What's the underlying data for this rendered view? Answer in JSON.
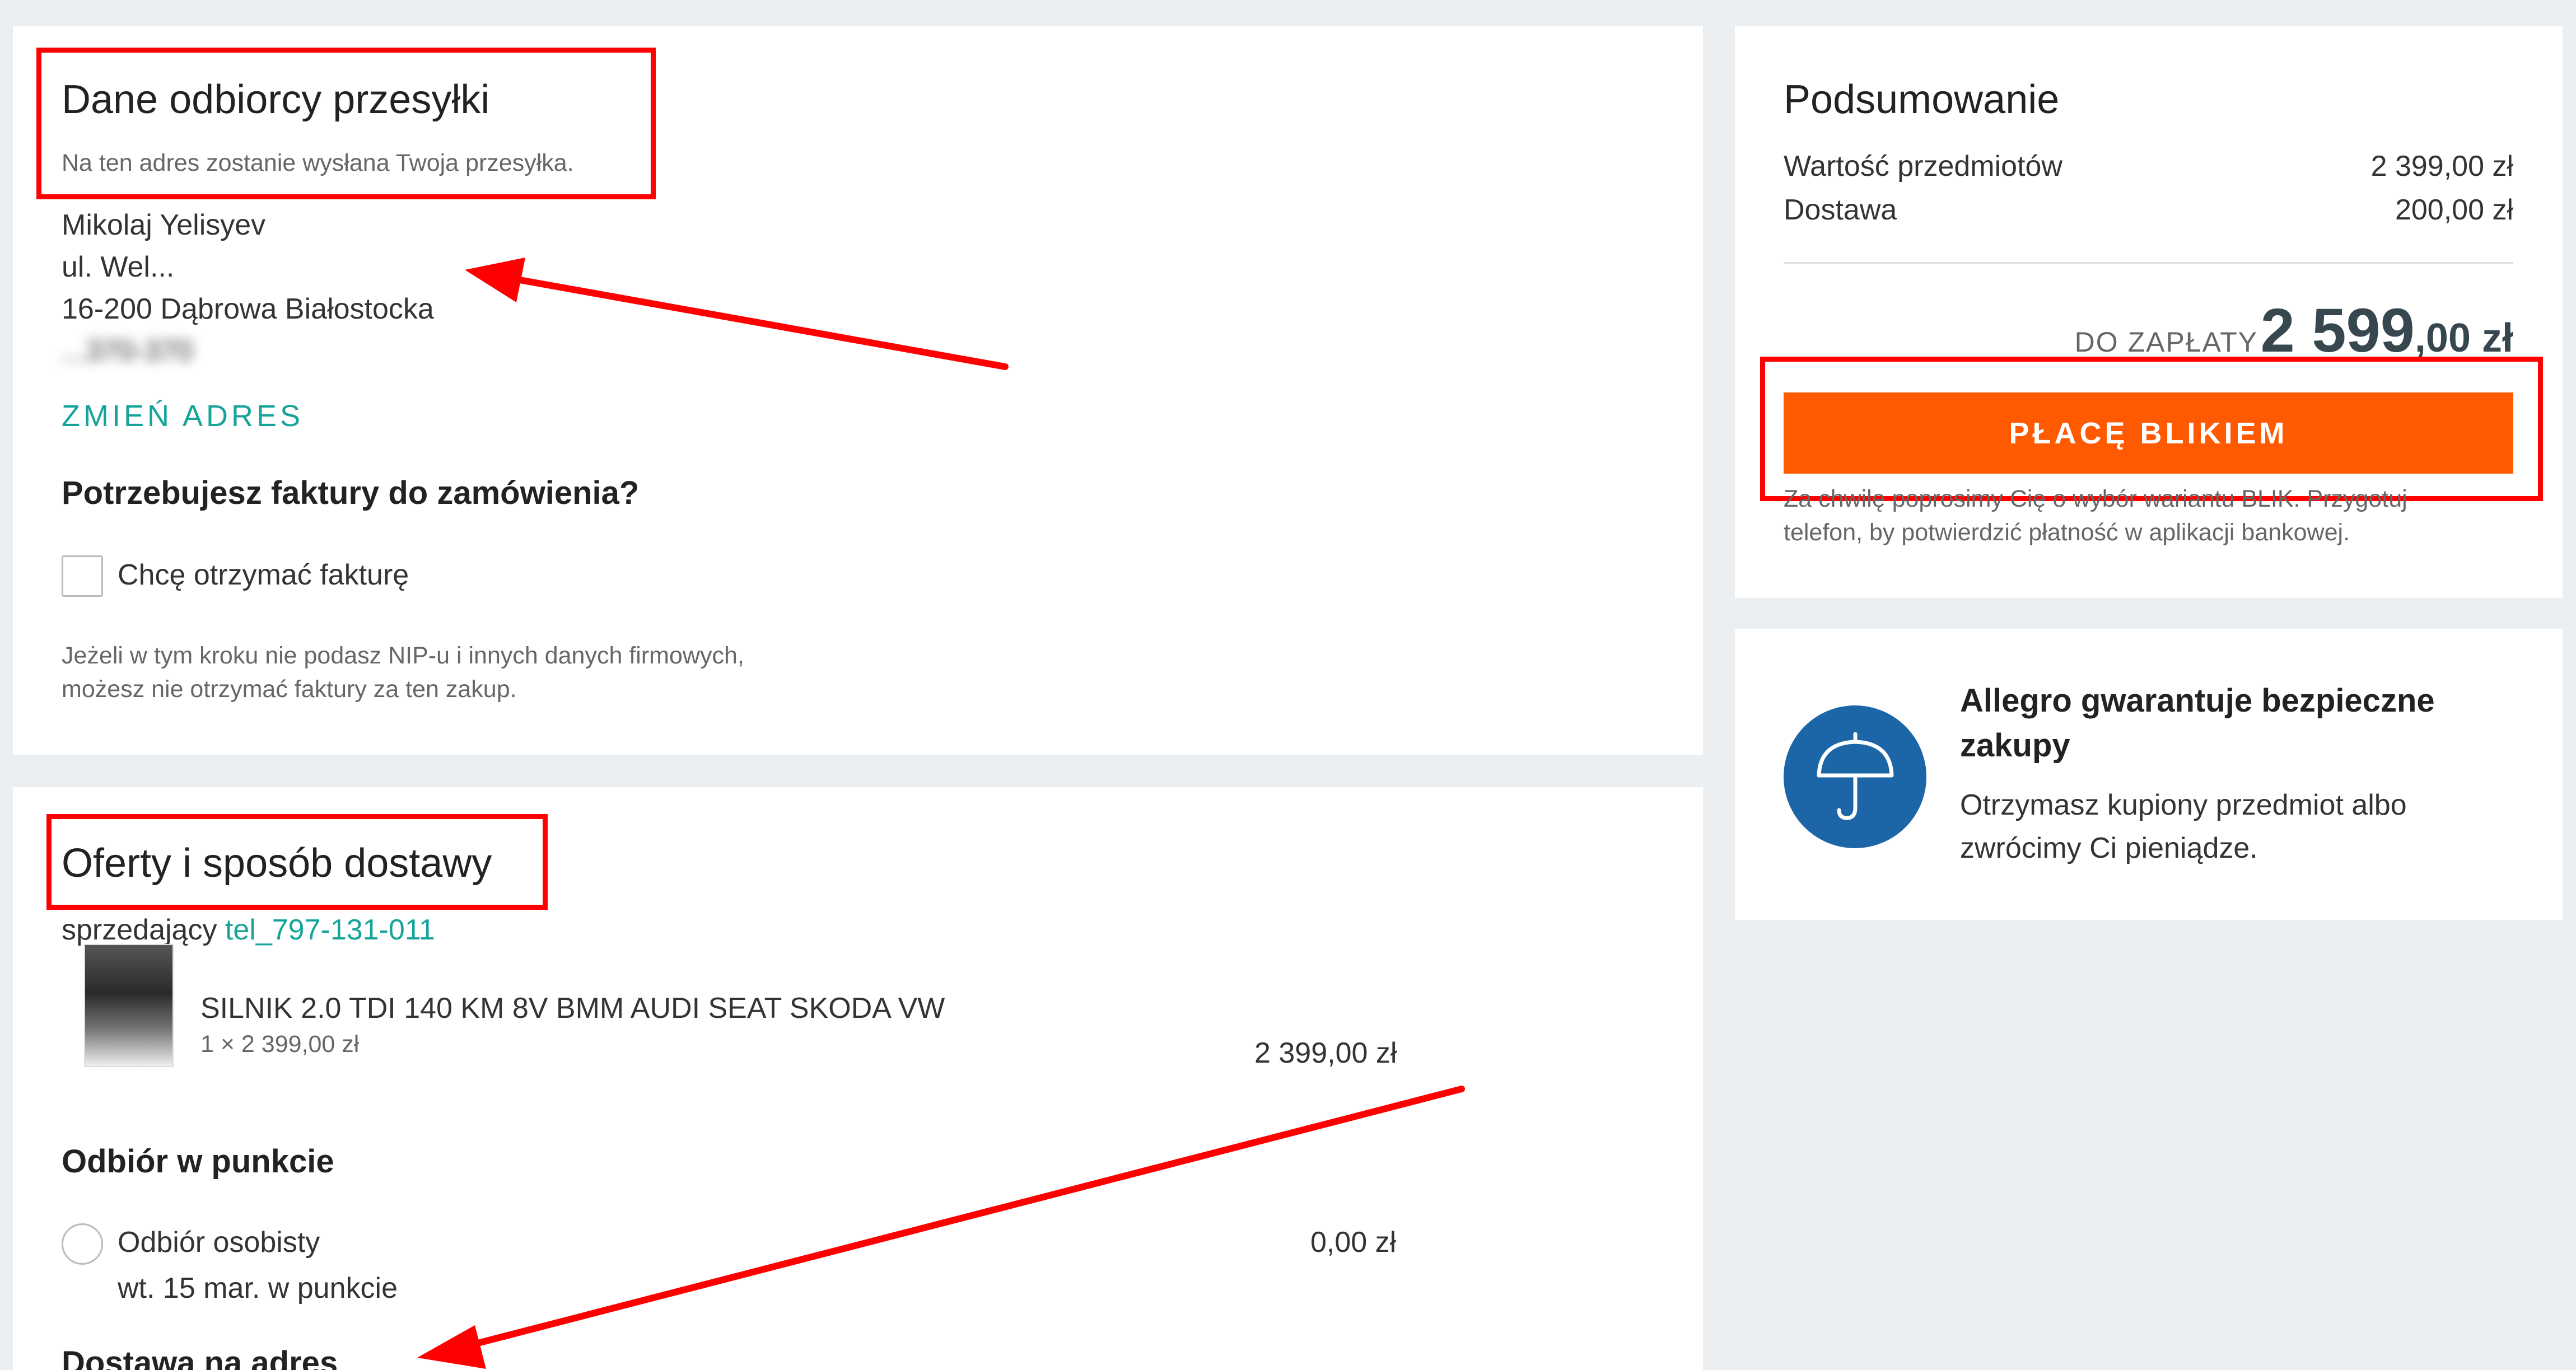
{
  "recipient": {
    "title": "Dane odbiorcy przesyłki",
    "subtitle": "Na ten adres zostanie wysłana Twoja przesyłka.",
    "address_lines": [
      "Mikolaj Yelisyev",
      "ul. Wel...",
      "16-200 Dąbrowa Białostocka",
      "...370-370"
    ],
    "change_address_link": "ZMIEŃ ADRES",
    "invoice_question": "Potrzebujesz faktury do zamówienia?",
    "invoice_checkbox_label": "Chcę otrzymać fakturę",
    "invoice_note_line1": "Jeżeli w tym kroku nie podasz NIP-u i innych danych firmowych,",
    "invoice_note_line2": "możesz nie otrzymać faktury za ten zakup."
  },
  "offers": {
    "title": "Oferty i sposób dostawy",
    "seller_prefix": "sprzedający",
    "seller_name": "tel_797-131-011",
    "item": {
      "name": "SILNIK 2.0 TDI 140 KM 8V BMM AUDI SEAT SKODA VW",
      "qty_price": "1 × 2 399,00 zł",
      "total": "2 399,00 zł"
    },
    "pickup_heading": "Odbiór w punkcie",
    "pickup_option_label": "Odbiór osobisty",
    "pickup_option_date": "wt. 15 mar. w punkcie",
    "pickup_option_price": "0,00 zł",
    "delivery_heading": "Dostawa na adres"
  },
  "summary": {
    "title": "Podsumowanie",
    "items_label": "Wartość przedmiotów",
    "items_value": "2 399,00 zł",
    "delivery_label": "Dostawa",
    "delivery_value": "200,00 zł",
    "to_pay_label": "DO ZAPŁATY",
    "to_pay_main": "2 599",
    "to_pay_cents": ",00 zł",
    "pay_button": "PŁACĘ BLIKIEM",
    "blik_note_line1": "Za chwilę poprosimy Cię o wybór wariantu BLIK. Przygotuj",
    "blik_note_line2": "telefon, by potwierdzić płatność w aplikacji bankowej."
  },
  "guarantee": {
    "title_line1": "Allegro gwarantuje bezpieczne",
    "title_line2": "zakupy",
    "text_line1": "Otrzymasz kupiony przedmiot albo",
    "text_line2": "zwrócimy Ci pieniądze."
  },
  "colors": {
    "accent_orange": "#ff5a00",
    "link_teal": "#16a49a",
    "annotation_red": "#ff0000",
    "guarantee_blue": "#1c66a8"
  },
  "icons": {
    "guarantee": "umbrella-icon",
    "product": "engine-thumbnail"
  }
}
